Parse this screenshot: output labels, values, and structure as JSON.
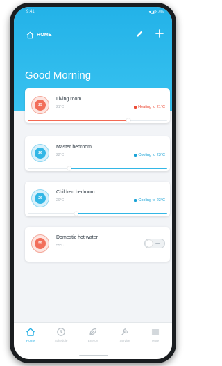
{
  "status_bar": {
    "time": "9:41",
    "indicators": "▾◢ 87%"
  },
  "header": {
    "home_label": "HOME",
    "home_icon": "home-icon",
    "edit_icon": "pencil-icon",
    "add_icon": "plus-icon",
    "greeting": "Good Morning"
  },
  "colors": {
    "accent": "#23b2e8",
    "heating": "#ec4b36",
    "cooling": "#1ba3d6"
  },
  "rooms": [
    {
      "name": "Living room",
      "current_temp": "21°C",
      "status": "Heating to 21°C",
      "mode": "heating",
      "icon_label": "25",
      "progress": 0.72
    },
    {
      "name": "Master bedroom",
      "current_temp": "22°C",
      "status": "Cooling to 23°C",
      "mode": "cooling",
      "icon_label": "26",
      "progress": 0.3
    },
    {
      "name": "Children bedroom",
      "current_temp": "20°C",
      "status": "Cooling to 23°C",
      "mode": "cooling",
      "icon_label": "26",
      "progress": 0.35
    },
    {
      "name": "Domestic hot water",
      "current_temp": "55°C",
      "mode": "off",
      "icon_label": "55",
      "toggle_on": false
    }
  ],
  "nav": [
    {
      "label": "Home",
      "icon": "home-icon",
      "active": true
    },
    {
      "label": "Schedule",
      "icon": "clock-icon",
      "active": false
    },
    {
      "label": "Energy",
      "icon": "leaf-icon",
      "active": false
    },
    {
      "label": "Service",
      "icon": "wrench-icon",
      "active": false
    },
    {
      "label": "More",
      "icon": "menu-icon",
      "active": false
    }
  ]
}
